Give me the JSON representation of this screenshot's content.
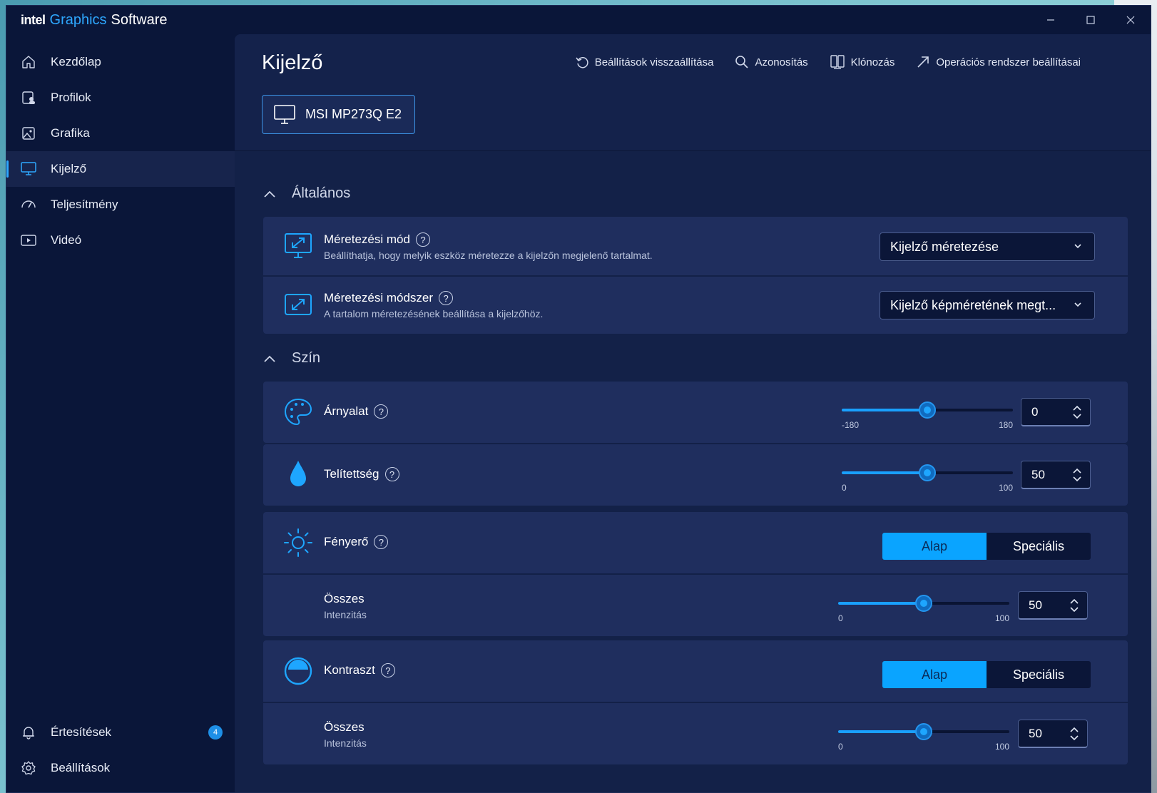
{
  "app": {
    "brand_intel": "intel",
    "brand_graphics": "Graphics",
    "brand_software": "Software",
    "accent": "#2ea8ff"
  },
  "window_controls": {
    "minimize": "—",
    "maximize": "☐",
    "close": "✕"
  },
  "sidebar": {
    "items": [
      {
        "label": "Kezdőlap",
        "icon": "home-icon"
      },
      {
        "label": "Profilok",
        "icon": "profiles-icon"
      },
      {
        "label": "Grafika",
        "icon": "image-icon"
      },
      {
        "label": "Kijelző",
        "icon": "monitor-icon",
        "active": true
      },
      {
        "label": "Teljesítmény",
        "icon": "gauge-icon"
      },
      {
        "label": "Videó",
        "icon": "video-icon"
      }
    ],
    "bottom": [
      {
        "label": "Értesítések",
        "icon": "bell-icon",
        "badge": "4"
      },
      {
        "label": "Beállítások",
        "icon": "gear-icon"
      }
    ]
  },
  "header": {
    "title": "Kijelző",
    "actions": {
      "reset": "Beállítások visszaállítása",
      "identify": "Azonosítás",
      "clone": "Klónozás",
      "os_settings": "Operációs rendszer beállításai"
    },
    "monitor": "MSI MP273Q E2"
  },
  "general": {
    "heading": "Általános",
    "scaling_mode": {
      "title": "Méretezési mód",
      "desc": "Beállíthatja, hogy melyik eszköz méretezze a kijelzőn megjelenő tartalmat.",
      "value": "Kijelző méretezése"
    },
    "scaling_method": {
      "title": "Méretezési módszer",
      "desc": "A tartalom méretezésének beállítása a kijelzőhöz.",
      "value": "Kijelző képméretének megt..."
    }
  },
  "color": {
    "heading": "Szín",
    "hue": {
      "title": "Árnyalat",
      "min": "-180",
      "max": "180",
      "value": "0",
      "fraction": 0.5
    },
    "saturation": {
      "title": "Telítettség",
      "min": "0",
      "max": "100",
      "value": "50",
      "fraction": 0.5
    },
    "brightness": {
      "title": "Fényerő",
      "toggle_on": "Alap",
      "toggle_off": "Speciális",
      "sub_title": "Összes",
      "sub_desc": "Intenzitás",
      "min": "0",
      "max": "100",
      "value": "50",
      "fraction": 0.5
    },
    "contrast": {
      "title": "Kontraszt",
      "toggle_on": "Alap",
      "toggle_off": "Speciális",
      "sub_title": "Összes",
      "sub_desc": "Intenzitás",
      "min": "0",
      "max": "100",
      "value": "50",
      "fraction": 0.5
    }
  },
  "help_glyph": "?"
}
